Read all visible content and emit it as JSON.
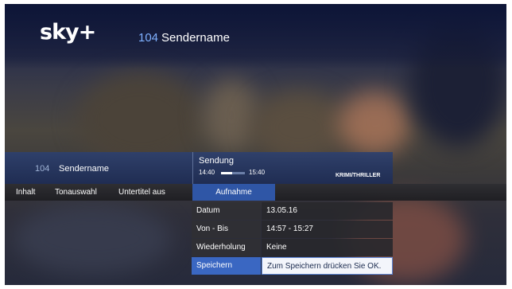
{
  "header": {
    "logo": "sky+",
    "channel_number": "104",
    "channel_name": "Sendername"
  },
  "info_bar": {
    "channel_number": "104",
    "channel_name": "Sendername",
    "program_label": "Sendung",
    "start_time": "14:40",
    "end_time": "15:40",
    "progress": 0.45,
    "genre": "KRIMI/THRILLER"
  },
  "menu": {
    "tabs": [
      {
        "label": "Inhalt"
      },
      {
        "label": "Tonauswahl"
      },
      {
        "label": "Untertitel aus"
      },
      {
        "label": "Aufnahme"
      }
    ],
    "active_tab": "Aufnahme"
  },
  "submenu": {
    "rows": [
      {
        "label": "Datum",
        "value": "13.05.16"
      },
      {
        "label": "Von - Bis",
        "value": "14:57 - 15:27"
      },
      {
        "label": "Wiederholung",
        "value": "Keine"
      },
      {
        "label": "Speichern",
        "value": "Zum Speichern drücken Sie OK."
      }
    ],
    "selected": "Speichern"
  },
  "colors": {
    "accent": "#2f56a6",
    "selected_label": "#3a67c2",
    "channel_number": "#7fb1ff"
  }
}
